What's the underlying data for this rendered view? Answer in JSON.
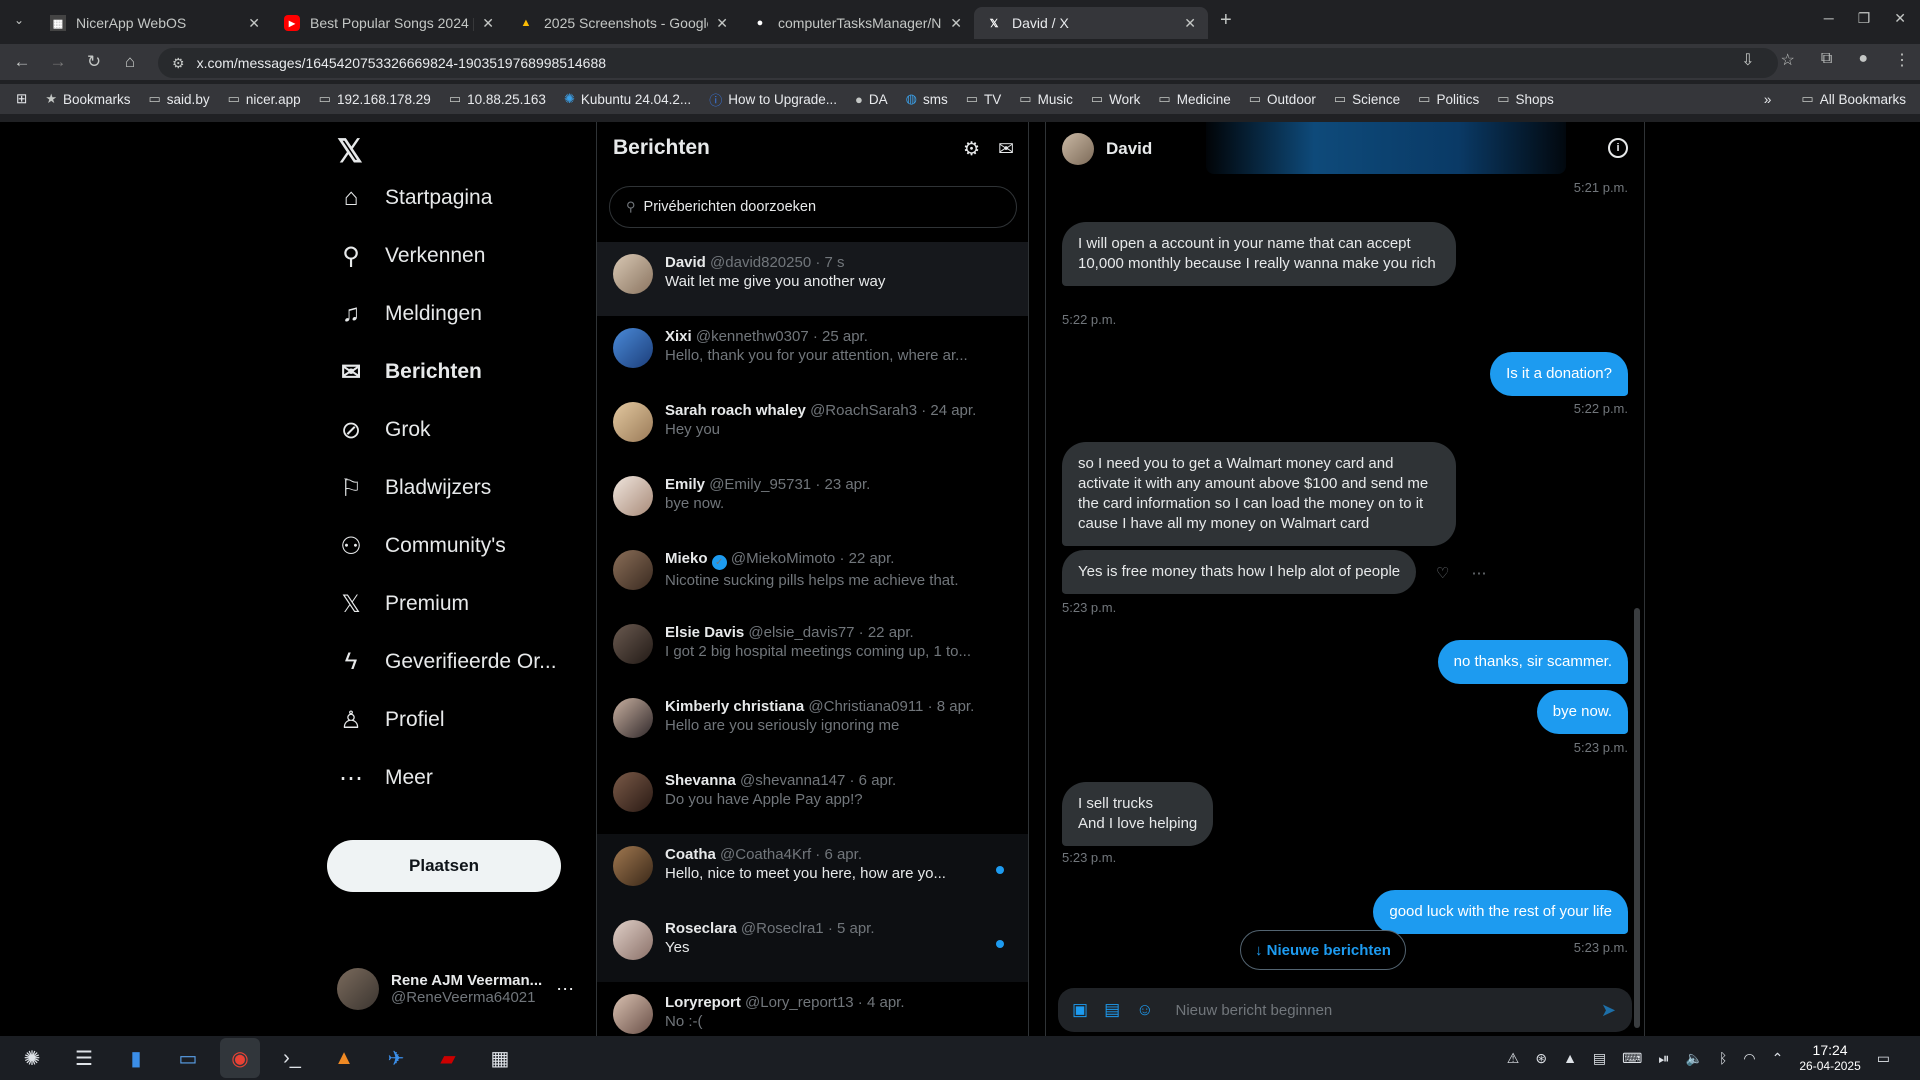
{
  "browser": {
    "tabs": [
      {
        "title": "NicerApp WebOS",
        "active": false
      },
      {
        "title": "Best Popular Songs 2024 |",
        "active": false
      },
      {
        "title": "2025 Screenshots - Google",
        "active": false
      },
      {
        "title": "computerTasksManager/N",
        "active": false
      },
      {
        "title": "David / X",
        "active": true
      }
    ],
    "url": "x.com/messages/1645420753326669824-1903519768998514688",
    "bookmarks": [
      "Bookmarks",
      "said.by",
      "nicer.app",
      "192.168.178.29",
      "10.88.25.163",
      "Kubuntu 24.04.2...",
      "How to Upgrade...",
      "DA",
      "sms",
      "TV",
      "Music",
      "Work",
      "Medicine",
      "Outdoor",
      "Science",
      "Politics",
      "Shops"
    ],
    "all_bookmarks": "All Bookmarks"
  },
  "nav": {
    "items": [
      {
        "label": "Startpagina",
        "icon": "home-icon"
      },
      {
        "label": "Verkennen",
        "icon": "search-icon"
      },
      {
        "label": "Meldingen",
        "icon": "bell-icon"
      },
      {
        "label": "Berichten",
        "icon": "envelope-icon"
      },
      {
        "label": "Grok",
        "icon": "grok-icon"
      },
      {
        "label": "Bladwijzers",
        "icon": "bookmark-icon"
      },
      {
        "label": "Community's",
        "icon": "community-icon"
      },
      {
        "label": "Premium",
        "icon": "x-icon"
      },
      {
        "label": "Geverifieerde Or...",
        "icon": "lightning-icon"
      },
      {
        "label": "Profiel",
        "icon": "person-icon"
      },
      {
        "label": "Meer",
        "icon": "more-icon"
      }
    ],
    "post_label": "Plaatsen",
    "account_name": "Rene AJM Veerman...",
    "account_handle": "@ReneVeerma64021"
  },
  "messages": {
    "title": "Berichten",
    "search_placeholder": "Privéberichten doorzoeken",
    "conversations": [
      {
        "name": "David",
        "meta": "@david820250 · 7 s",
        "preview": "Wait let me give you another way",
        "unread": true
      },
      {
        "name": "Xixi",
        "meta": "@kennethw0307 · 25 apr.",
        "preview": "Hello, thank you for your attention, where ar...",
        "unread": false
      },
      {
        "name": "Sarah roach whaley",
        "meta": "@RoachSarah3 · 24 apr.",
        "preview": "Hey you",
        "unread": false
      },
      {
        "name": "Emily",
        "meta": "@Emily_95731 · 23 apr.",
        "preview": "bye now.",
        "unread": false
      },
      {
        "name": "Mieko",
        "meta": "@MiekoMimoto · 22 apr.",
        "preview": "Nicotine sucking pills helps me achieve that.",
        "unread": false
      },
      {
        "name": "Elsie Davis",
        "meta": "@elsie_davis77 · 22 apr.",
        "preview": "I got 2 big hospital meetings coming up, 1 to...",
        "unread": false
      },
      {
        "name": "Kimberly christiana",
        "meta": "@Christiana0911 · 8 apr.",
        "preview": "Hello are you seriously ignoring me",
        "unread": false
      },
      {
        "name": "Shevanna",
        "meta": "@shevanna147 · 6 apr.",
        "preview": "Do you have Apple Pay app!?",
        "unread": false
      },
      {
        "name": "Coatha",
        "meta": "@Coatha4Krf · 6 apr.",
        "preview": "Hello, nice to meet you here, how are yo...",
        "unread": true
      },
      {
        "name": "Roseclara",
        "meta": "@Roseclra1 · 5 apr.",
        "preview": "Yes",
        "unread": true
      },
      {
        "name": "Loryreport",
        "meta": "@Lory_report13 · 4 apr.",
        "preview": "No :-(",
        "unread": false
      }
    ]
  },
  "chat": {
    "name": "David",
    "top_time": "5:21 p.m.",
    "messages": [
      {
        "text": "I will open a account in your name that can accept 10,000 monthly because I really wanna make you rich",
        "time": "5:22 p.m."
      },
      {
        "text": "Is it a donation?",
        "time": "5:22 p.m."
      },
      {
        "text": "so I need you to get a Walmart money card and activate it with any amount above $100 and send me the card information so I can load the money on to it cause I have all my money on Walmart card",
        "time": ""
      },
      {
        "text": "Yes is free money thats how I help alot of people",
        "time": "5:23 p.m."
      },
      {
        "text": "no thanks, sir scammer.",
        "time": ""
      },
      {
        "text": "bye now.",
        "time": "5:23 p.m."
      },
      {
        "text": "I sell trucks\nAnd I love helping",
        "time": "5:23 p.m."
      },
      {
        "text": "good luck with the rest of your life",
        "time": "5:23 p.m."
      }
    ],
    "new_messages_label": "↓ Nieuwe berichten",
    "composer_placeholder": "Nieuw bericht beginnen"
  },
  "taskbar": {
    "time": "17:24",
    "date": "26-04-2025"
  },
  "colors": {
    "accent": "#1d9bf0",
    "bubble_in": "#2f3336"
  }
}
